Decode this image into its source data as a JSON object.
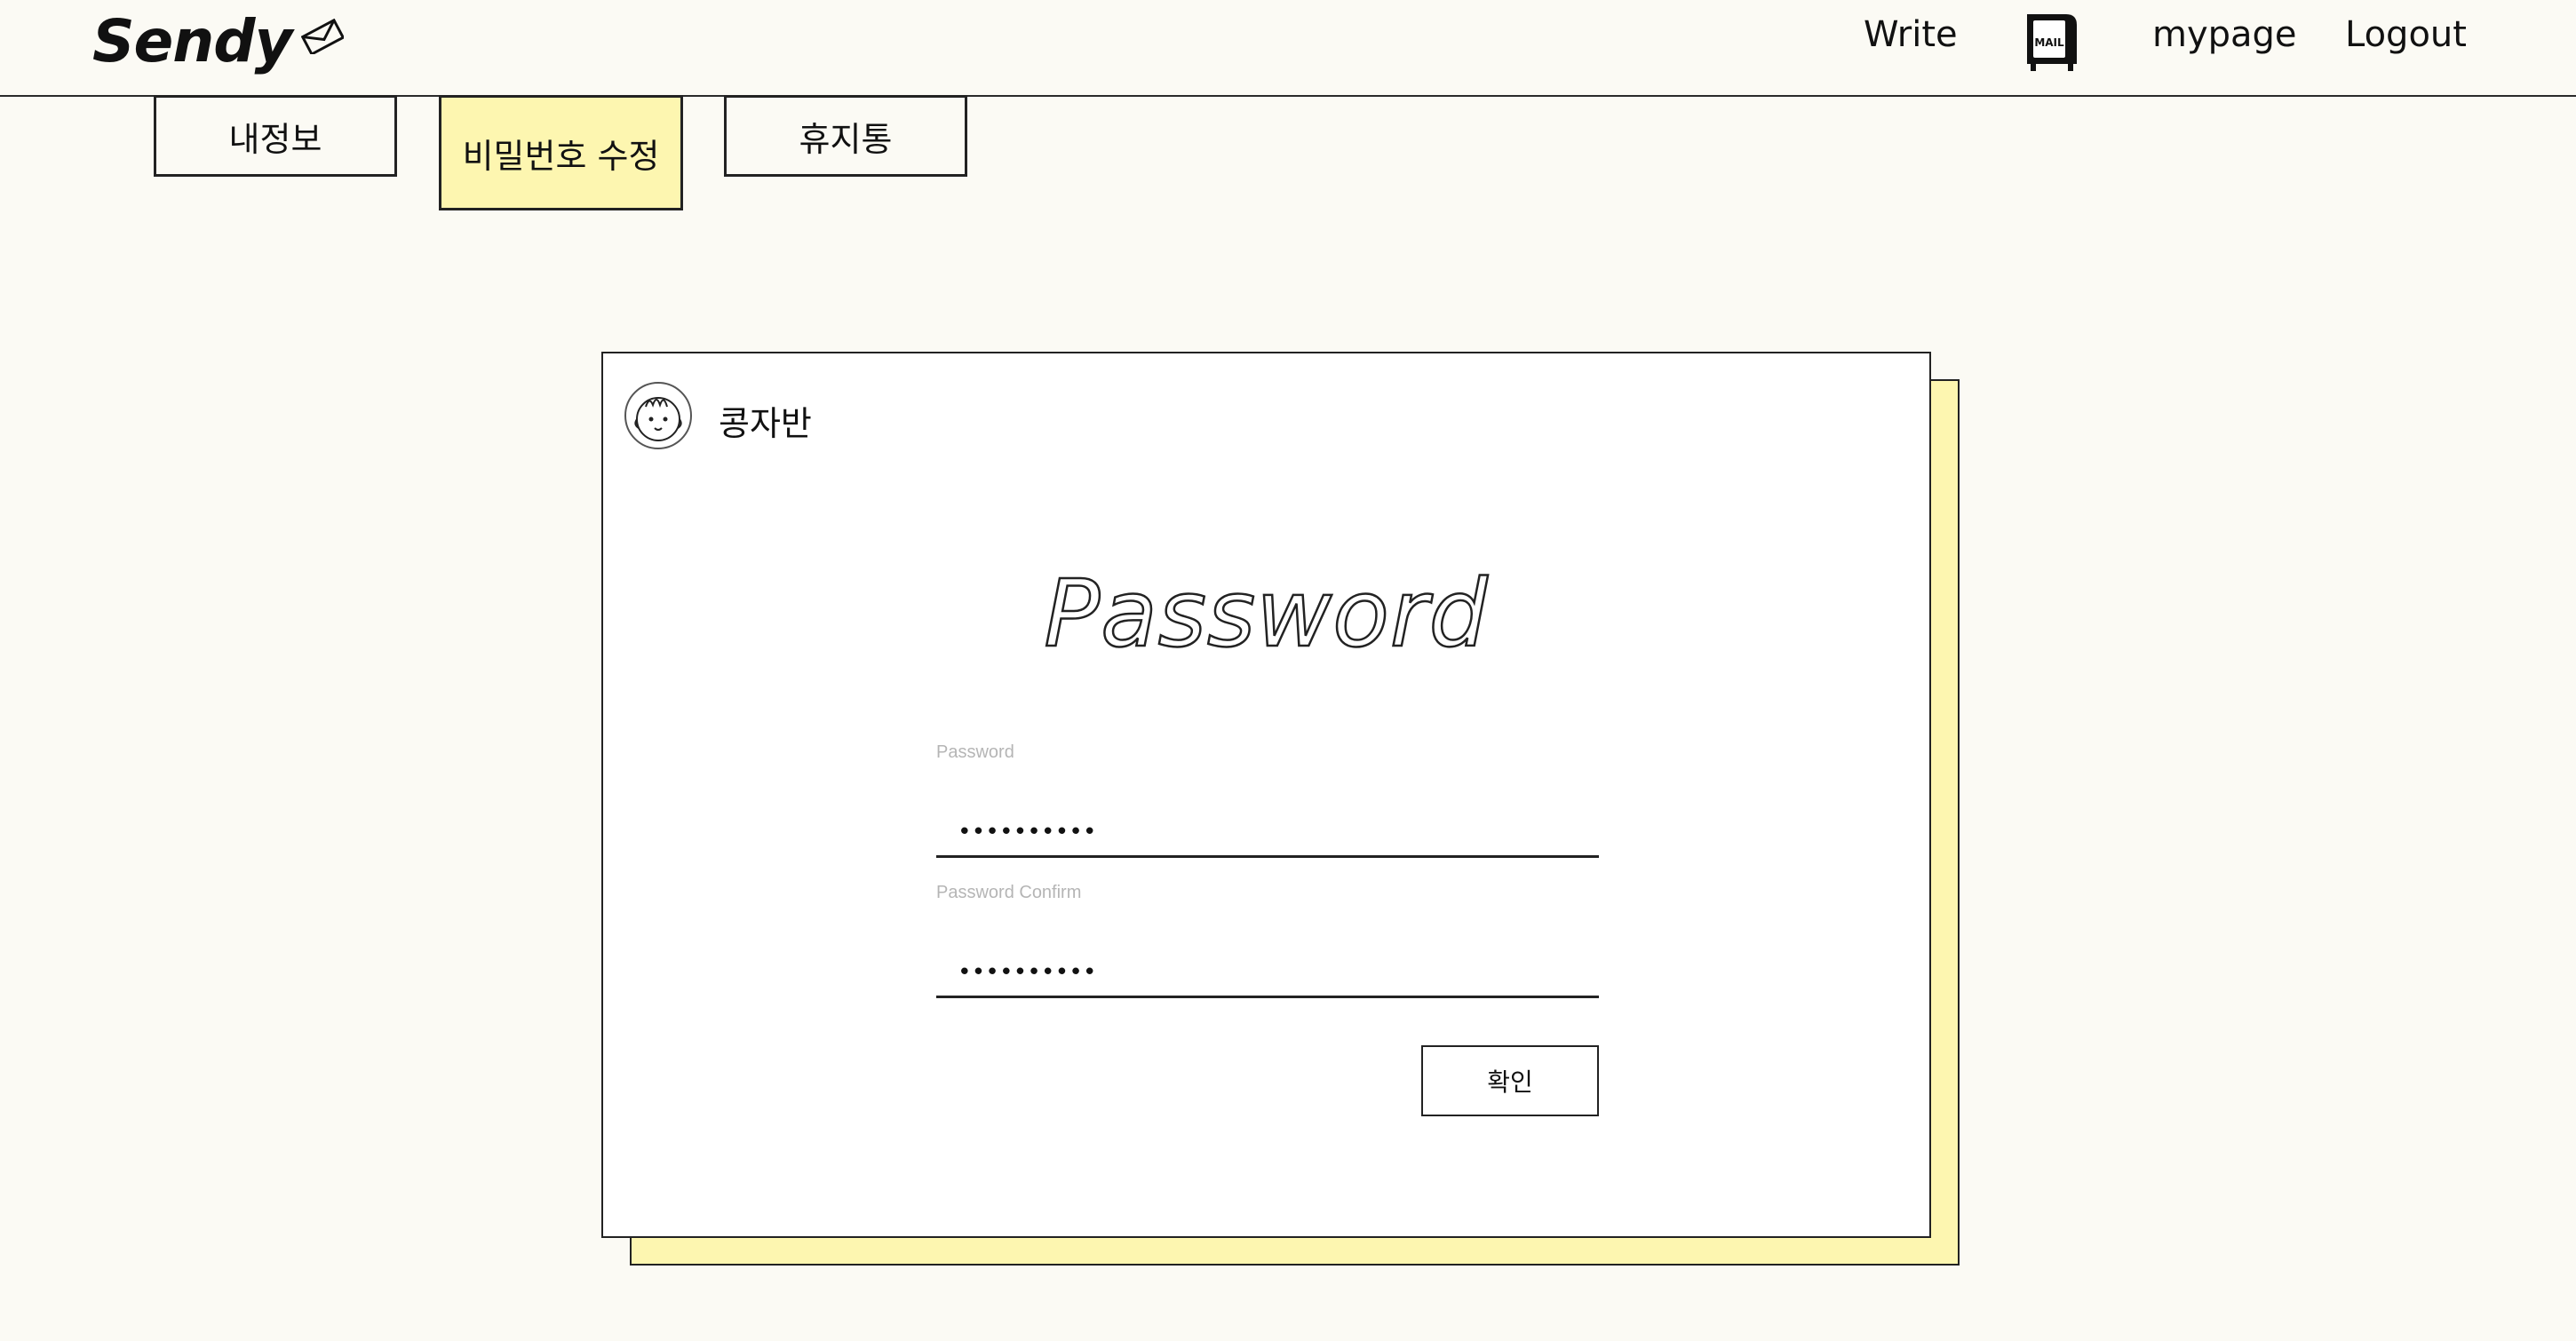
{
  "header": {
    "logo": "Sendy",
    "nav": {
      "write": "Write",
      "mailbox_label": "MAIL",
      "mypage": "mypage",
      "logout": "Logout"
    }
  },
  "tabs": [
    {
      "label": "내정보",
      "active": false
    },
    {
      "label": "비밀번호 수정",
      "active": true
    },
    {
      "label": "휴지통",
      "active": false
    }
  ],
  "card": {
    "username": "콩자반",
    "heading": "Password",
    "fields": {
      "password_label": "Password",
      "password_value": "••••••••••",
      "confirm_label": "Password Confirm",
      "confirm_value": "••••••••••"
    },
    "confirm_button": "확인"
  },
  "colors": {
    "background": "#fbfaf4",
    "accent_yellow": "#fdf6b0",
    "border": "#222222"
  },
  "icons": {
    "logo": "paper-plane-envelope-icon",
    "mailbox": "mailbox-icon",
    "avatar": "cartoon-face-avatar"
  }
}
